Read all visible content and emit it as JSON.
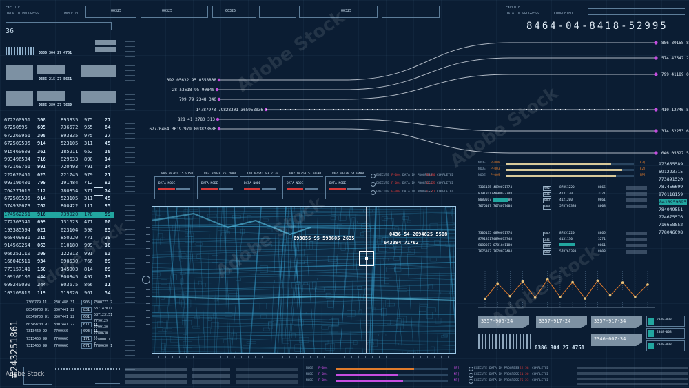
{
  "colors": {
    "background": "#0b1d33",
    "accent_teal": "#22a6a0",
    "accent_orange": "#e07b2c",
    "accent_red": "#d83a3a",
    "accent_magenta": "#c64de0",
    "map_blue": "#3db3e6",
    "line_pale": "#e8eef5"
  },
  "top_status": {
    "execute": "EXECUTE",
    "data_in_progress": "DATA IN PROGRESS",
    "completed": "COMPLETED",
    "code_a": "00325",
    "code_b": "00325",
    "code_c": "00325",
    "code_d": "00325",
    "code_e": "00325"
  },
  "serial": "8464-04-8418-52995",
  "left_counter": "36",
  "left_panels": [
    {
      "value": "0386 304 27 4751"
    },
    {
      "value": "0386 215 27 5651"
    },
    {
      "value": "0386 289 27 7630"
    }
  ],
  "left_table": [
    {
      "a": "672260961",
      "b": "308",
      "c": "893335",
      "d": "975",
      "e": "27"
    },
    {
      "a": "67250595",
      "b": "605",
      "c": "736572",
      "d": "955",
      "e": "84"
    },
    {
      "a": "672260961",
      "b": "308",
      "c": "893335",
      "d": "975",
      "e": "27"
    },
    {
      "a": "672509595",
      "b": "914",
      "c": "523105",
      "d": "311",
      "e": "45"
    },
    {
      "a": "915460603",
      "b": "361",
      "c": "185211",
      "d": "652",
      "e": "18"
    },
    {
      "a": "993496584",
      "b": "716",
      "c": "829633",
      "d": "890",
      "e": "14"
    },
    {
      "a": "672169761",
      "b": "991",
      "c": "720493",
      "d": "791",
      "e": "14"
    },
    {
      "a": "222620451",
      "b": "023",
      "c": "221745",
      "d": "979",
      "e": "21"
    },
    {
      "a": "093196401",
      "b": "799",
      "c": "191484",
      "d": "712",
      "e": "93"
    },
    {
      "a": "764271616",
      "b": "112",
      "c": "780354",
      "d": "371",
      "e": "74"
    },
    {
      "a": "672509595",
      "b": "914",
      "c": "523105",
      "d": "311",
      "e": "45"
    },
    {
      "a": "574930673",
      "b": "762",
      "c": "800422",
      "d": "111",
      "e": "95"
    },
    {
      "a": "174562251",
      "b": "916",
      "c": "739920",
      "d": "178",
      "e": "59"
    },
    {
      "a": "772303341",
      "b": "699",
      "c": "131623",
      "d": "471",
      "e": "00"
    },
    {
      "a": "193385594",
      "b": "021",
      "c": "023104",
      "d": "590",
      "e": "85"
    },
    {
      "a": "660409631",
      "b": "315",
      "c": "850220",
      "d": "771",
      "e": "29"
    },
    {
      "a": "914569254",
      "b": "063",
      "c": "810180",
      "d": "999",
      "e": "18"
    },
    {
      "a": "066251110",
      "b": "309",
      "c": "122912",
      "d": "991",
      "e": "03"
    },
    {
      "a": "166040511",
      "b": "934",
      "c": "890530",
      "d": "766",
      "e": "89"
    },
    {
      "a": "773157141",
      "b": "150",
      "c": "145903",
      "d": "814",
      "e": "69"
    },
    {
      "a": "109166106",
      "b": "444",
      "c": "800345",
      "d": "497",
      "e": "79"
    },
    {
      "a": "690240090",
      "b": "344",
      "c": "803675",
      "d": "866",
      "e": "11"
    },
    {
      "a": "103109810",
      "b": "119",
      "c": "519020",
      "d": "961",
      "e": "34"
    }
  ],
  "left_small_code": [
    {
      "a": "7300779 11",
      "b": "2301488 31",
      "c": "905"
    },
    {
      "a": "80349700 91",
      "b": "8007441 22",
      "c": "831"
    },
    {
      "a": "80349700 91",
      "b": "8007441 22",
      "c": "601"
    },
    {
      "a": "80349700 91",
      "b": "8007441 22",
      "c": "611"
    },
    {
      "a": "7313460 99",
      "b": "7700660",
      "c": "093"
    },
    {
      "a": "7313460 99",
      "b": "7700660",
      "c": "171"
    },
    {
      "a": "7313460 99",
      "b": "7700660",
      "c": "671"
    }
  ],
  "left_small_right": [
    "7300777 7",
    "587142011",
    "587123151",
    "7790129 11",
    "7799130 11",
    "7780630 11",
    "77800011 7",
    "7780630 1"
  ],
  "flow_left": [
    {
      "label": "092 05632 95 0558808"
    },
    {
      "label": "28 53618 95 90840"
    },
    {
      "label": "799 79 2348 340"
    },
    {
      "label": "14787973 79828301 365958036"
    },
    {
      "label": "828 41 2780 313"
    },
    {
      "label": "62770464 36197979 803828686"
    }
  ],
  "flow_right": [
    {
      "label": "886 80158 89"
    },
    {
      "label": "574 47547 24"
    },
    {
      "label": "799 41189 03"
    },
    {
      "label": "410 12746 58"
    },
    {
      "label": "314 52253 66"
    },
    {
      "label": "046 05627 51"
    }
  ],
  "node_boxes": [
    {
      "title": "806 99761 15 9150",
      "node": "DATA NODE"
    },
    {
      "title": "807 87048 75 7900",
      "node": "DATA NODE"
    },
    {
      "title": "170 07641 83 7130",
      "node": "DATA NODE"
    },
    {
      "title": "087 90750 57 0590",
      "node": "DATA NODE"
    },
    {
      "title": "862 08436 64 0408",
      "node": "DATA NODE"
    }
  ],
  "center_status": [
    {
      "execute": "EXECUTE",
      "flag": "P-004",
      "data": "DATA IN PROGRESS",
      "pct": "98.80",
      "done": "COMPLETED"
    },
    {
      "execute": "EXECUTE",
      "flag": "P-004",
      "data": "DATA IN PROGRESS",
      "pct": "60.05",
      "done": "COMPLETED"
    },
    {
      "execute": "EXECUTE",
      "flag": "P-004",
      "data": "DATA IN PROGRESS",
      "pct": "23.47",
      "done": "COMPLETED"
    }
  ],
  "map_overlay": {
    "coord1": "693055 95 598605 2635",
    "coord2": "0436 54 2694825 5508",
    "coord3": "643394 71762"
  },
  "nodes_right": [
    {
      "node": "NODE",
      "flag": "P-009",
      "pct": 0.82,
      "tag": "[F3]"
    },
    {
      "node": "NODE",
      "flag": "P-003",
      "pct": 0.91,
      "tag": "[F2]"
    },
    {
      "node": "NODE",
      "flag": "P-009",
      "pct": 0.86,
      "tag": "[NP]"
    }
  ],
  "right_numbers": [
    "973655589",
    "691223715",
    "773891520",
    "787456699",
    "970118159",
    "8418959695",
    "784049551",
    "774675576",
    "716658852",
    "778046098"
  ],
  "right_numbers_highlight_index": 5,
  "right_tables": {
    "col1": [
      "7305115",
      "87918117",
      "8080017",
      "7676107",
      "7305115",
      "87918117",
      "8080017",
      "7676107"
    ],
    "col2": [
      "4890071774",
      "4890073748",
      "0781041180",
      "7678077404",
      "4890071774",
      "4890073748",
      "0781041180",
      "7678077404"
    ],
    "col3": [
      "992",
      "231",
      "883",
      "000",
      "992",
      "231",
      "883",
      "000"
    ],
    "col4": [
      "87851220",
      "4131130",
      "4121200",
      "578761380",
      "87851220",
      "4131130",
      "4121200",
      "578761380"
    ],
    "col5": [
      "8865",
      "3271",
      "0861",
      "8008",
      "8865",
      "3271",
      "0861",
      "8008"
    ]
  },
  "line_chart": {
    "points": [
      0.15,
      0.55,
      0.22,
      0.6,
      0.18,
      0.65,
      0.2,
      0.58,
      0.16,
      0.62,
      0.24,
      0.57,
      0.2,
      0.52
    ]
  },
  "readout_tiles": [
    {
      "label": "3357-906-24"
    },
    {
      "label": "3357-917-24"
    },
    {
      "label": "3357-917-34"
    },
    {
      "label": "2346-607-34"
    }
  ],
  "small_tiles": [
    {
      "label": "2348-008"
    },
    {
      "label": "2348-008"
    },
    {
      "label": "2348-008"
    }
  ],
  "barcode_readout": "0386 304 27 4751",
  "bottom_nodes": [
    {
      "node": "NODE",
      "flag": "P-004",
      "tag": "[NP]",
      "pct": 0.7
    },
    {
      "node": "NODE",
      "flag": "P-004",
      "tag": "[NP]",
      "pct": 0.55
    },
    {
      "node": "NODE",
      "flag": "P-004",
      "tag": "[NP]",
      "pct": 0.6
    }
  ],
  "bottom_status": [
    {
      "execute": "EXECUTE",
      "data": "DATA IN PROGRESS",
      "pct": "22.58",
      "done": "COMPLETED"
    },
    {
      "execute": "EXECUTE",
      "data": "DATA IN PROGRESS",
      "pct": "51.20",
      "done": "COMPLETED"
    },
    {
      "execute": "EXECUTE",
      "data": "DATA IN PROGRESS",
      "pct": "76.23",
      "done": "COMPLETED"
    }
  ],
  "watermark": {
    "brand": "Adobe Stock",
    "id_number": "#243251861"
  }
}
